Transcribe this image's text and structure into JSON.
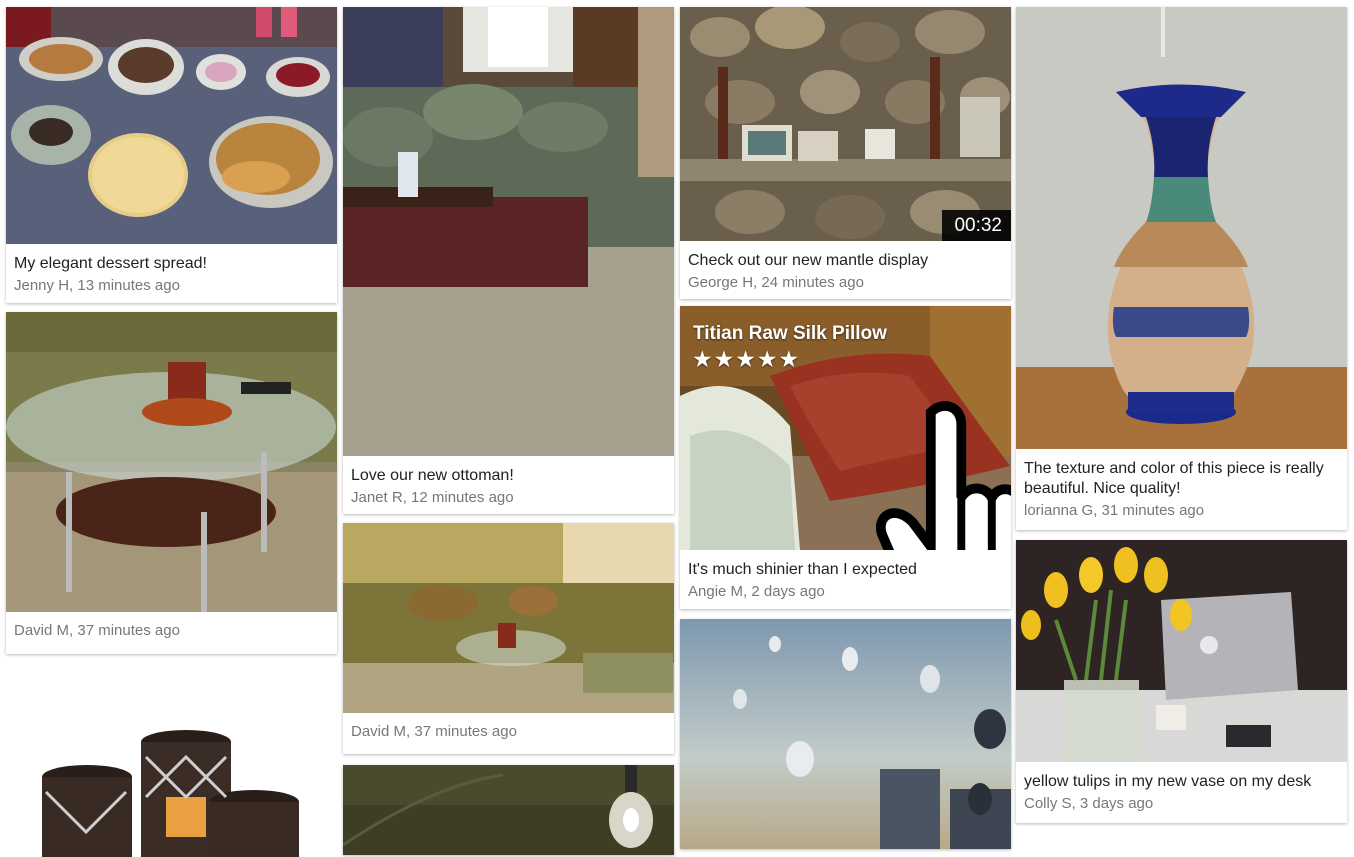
{
  "cards": {
    "dessert": {
      "title": "My elegant dessert spread!",
      "meta": "Jenny H, 13 minutes ago"
    },
    "table": {
      "meta": "David M, 37 minutes ago"
    },
    "ottoman": {
      "title": "Love our new ottoman!",
      "meta": "Janet R, 12 minutes ago"
    },
    "sofa": {
      "meta": "David M, 37 minutes ago"
    },
    "mantle": {
      "title": "Check out our new mantle display",
      "meta": "George H, 24 minutes ago",
      "duration": "00:32"
    },
    "pillow": {
      "overlay_title": "Titian Raw Silk Pillow",
      "stars": "★★★★★",
      "rating": 5,
      "title": "It's much shinier than I expected",
      "meta": "Angie M,  2 days ago"
    },
    "vase": {
      "title": "The texture and color of this piece is really beautiful. Nice quality!",
      "meta": "lorianna G, 31 minutes ago"
    },
    "tulips": {
      "title": "yellow tulips in my new vase on my desk",
      "meta": "Colly S, 3 days ago"
    }
  },
  "colors": {
    "title_text": "#222222",
    "meta_text": "#777777",
    "duration_bg": "#000000"
  }
}
